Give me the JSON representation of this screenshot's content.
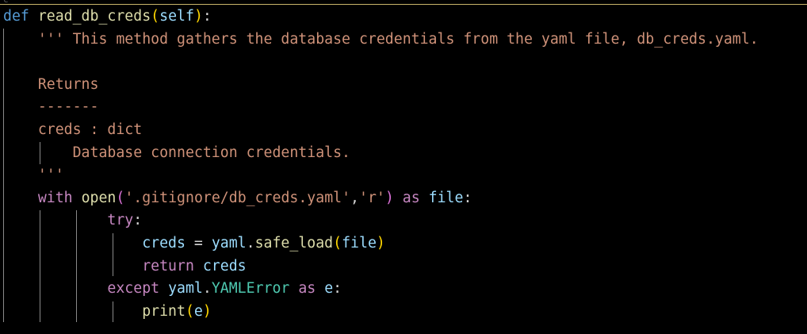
{
  "editor": {
    "top_cutoff": "c",
    "lines": [
      {
        "indent": "",
        "tokens": [
          {
            "t": "def",
            "c": "kw-blue"
          },
          {
            "t": " ",
            "c": "plain"
          },
          {
            "t": "read_db_creds",
            "c": "fn"
          },
          {
            "t": "(",
            "c": "paren1"
          },
          {
            "t": "self",
            "c": "param"
          },
          {
            "t": ")",
            "c": "paren1"
          },
          {
            "t": ":",
            "c": "plain"
          }
        ]
      },
      {
        "indent": "    ",
        "tokens": [
          {
            "t": "''' This method gathers the database credentials from the yaml file, db_creds.yaml.",
            "c": "str"
          }
        ]
      },
      {
        "indent": "",
        "tokens": []
      },
      {
        "indent": "    ",
        "tokens": [
          {
            "t": "Returns",
            "c": "str"
          }
        ]
      },
      {
        "indent": "    ",
        "tokens": [
          {
            "t": "-------",
            "c": "str"
          }
        ]
      },
      {
        "indent": "    ",
        "tokens": [
          {
            "t": "creds : dict",
            "c": "str"
          }
        ]
      },
      {
        "indent": "        ",
        "tokens": [
          {
            "t": "Database connection credentials.",
            "c": "str"
          }
        ]
      },
      {
        "indent": "    ",
        "tokens": [
          {
            "t": "'''",
            "c": "str"
          }
        ]
      },
      {
        "indent": "    ",
        "tokens": [
          {
            "t": "with",
            "c": "kw-purple"
          },
          {
            "t": " ",
            "c": "plain"
          },
          {
            "t": "open",
            "c": "fn"
          },
          {
            "t": "(",
            "c": "paren2"
          },
          {
            "t": "'.gitignore/db_creds.yaml'",
            "c": "str"
          },
          {
            "t": ",",
            "c": "plain"
          },
          {
            "t": "'r'",
            "c": "str"
          },
          {
            "t": ")",
            "c": "paren2"
          },
          {
            "t": " ",
            "c": "plain"
          },
          {
            "t": "as",
            "c": "kw-purple"
          },
          {
            "t": " ",
            "c": "plain"
          },
          {
            "t": "file",
            "c": "param"
          },
          {
            "t": ":",
            "c": "plain"
          }
        ]
      },
      {
        "indent": "            ",
        "tokens": [
          {
            "t": "try",
            "c": "kw-purple"
          },
          {
            "t": ":",
            "c": "plain"
          }
        ]
      },
      {
        "indent": "                ",
        "tokens": [
          {
            "t": "creds",
            "c": "param"
          },
          {
            "t": " = ",
            "c": "plain"
          },
          {
            "t": "yaml",
            "c": "param"
          },
          {
            "t": ".",
            "c": "plain"
          },
          {
            "t": "safe_load",
            "c": "fn"
          },
          {
            "t": "(",
            "c": "paren1"
          },
          {
            "t": "file",
            "c": "param"
          },
          {
            "t": ")",
            "c": "paren1"
          }
        ]
      },
      {
        "indent": "                ",
        "tokens": [
          {
            "t": "return",
            "c": "kw-purple"
          },
          {
            "t": " ",
            "c": "plain"
          },
          {
            "t": "creds",
            "c": "param"
          }
        ]
      },
      {
        "indent": "            ",
        "tokens": [
          {
            "t": "except",
            "c": "kw-purple"
          },
          {
            "t": " ",
            "c": "plain"
          },
          {
            "t": "yaml",
            "c": "param"
          },
          {
            "t": ".",
            "c": "plain"
          },
          {
            "t": "YAMLError",
            "c": "cls"
          },
          {
            "t": " ",
            "c": "plain"
          },
          {
            "t": "as",
            "c": "kw-purple"
          },
          {
            "t": " ",
            "c": "plain"
          },
          {
            "t": "e",
            "c": "param"
          },
          {
            "t": ":",
            "c": "plain"
          }
        ]
      },
      {
        "indent": "                ",
        "tokens": [
          {
            "t": "print",
            "c": "fn"
          },
          {
            "t": "(",
            "c": "paren1"
          },
          {
            "t": "e",
            "c": "param"
          },
          {
            "t": ")",
            "c": "paren1"
          }
        ]
      }
    ]
  },
  "colors": {
    "background": "#000000",
    "keyword_blue": "#569cd6",
    "keyword_purple": "#c586c0",
    "function": "#dcdcaa",
    "variable": "#9cdcfe",
    "string": "#ce9178",
    "bracket_gold": "#ffd700",
    "bracket_orchid": "#da70d6",
    "class": "#4ec9b0",
    "indent_guide": "#8a8a8a"
  }
}
